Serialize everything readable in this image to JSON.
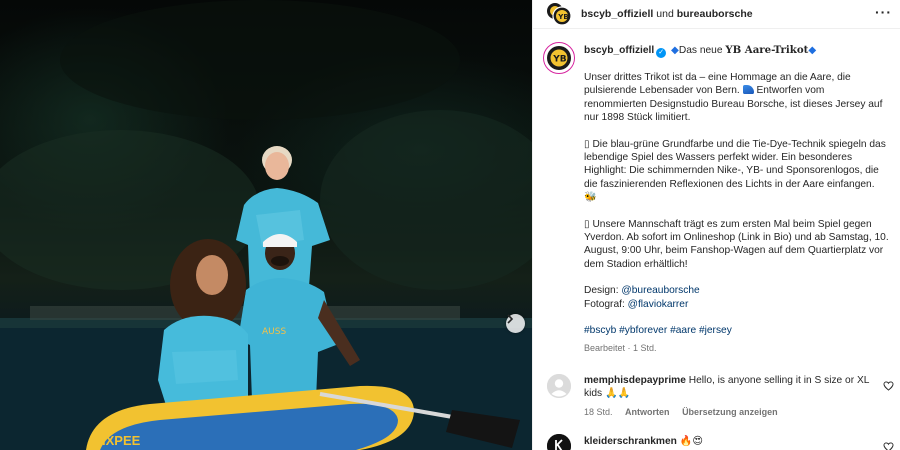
{
  "header": {
    "account": "bscyb_offiziell",
    "conjunction": "und",
    "collaborator": "bureauborsche",
    "more_icon": "more-horizontal-icon"
  },
  "post": {
    "username": "bscyb_offiziell",
    "title_prefix": "Das neue",
    "title_bold": "YB Aare-Trikot",
    "caption": [
      "Unser drittes Trikot ist da – eine Hommage an die Aare, die pulsierende Lebensader von Bern.",
      "Entworfen vom renommierten Designstudio Bureau Borsche, ist dieses Jersey auf nur 1898 Stück limitiert.",
      "Die blau-grüne Grundfarbe und die Tie-Dye-Technik spiegeln das lebendige Spiel des Wassers perfekt wider. Ein besonderes Highlight: Die schimmernden Nike-, YB- und Sponsorenlogos, die die faszinierenden Reflexionen des Lichts in der Aare einfangen.",
      "Unsere Mannschaft trägt es zum ersten Mal beim Spiel gegen Yverdon. Ab sofort im Onlineshop (Link in Bio) und ab Samstag, 10. August, 9:00 Uhr, beim Fanshop-Wagen auf dem Quartierplatz vor dem Stadion erhältlich!"
    ],
    "design_label": "Design:",
    "design_link": "@bureauborsche",
    "photo_label": "Fotograf:",
    "photo_link": "@flaviokarrer",
    "hashtags": "#bscyb #ybforever #aare #jersey",
    "edited": "Bearbeitet",
    "time": "1 Std."
  },
  "comments": [
    {
      "username": "memphisdepayprime",
      "text": "Hello, is anyone selling it in S size or XL kids 🙏🙏",
      "time": "18 Std.",
      "reply": "Antworten",
      "translate": "Übersetzung anzeigen"
    },
    {
      "username": "kleiderschrankmen",
      "text": "🔥😍"
    }
  ],
  "colors": {
    "link": "#00376b",
    "meta": "#737373",
    "verified": "#0095f6",
    "jersey": "#3fb6d8",
    "boat": "#f2c230"
  }
}
